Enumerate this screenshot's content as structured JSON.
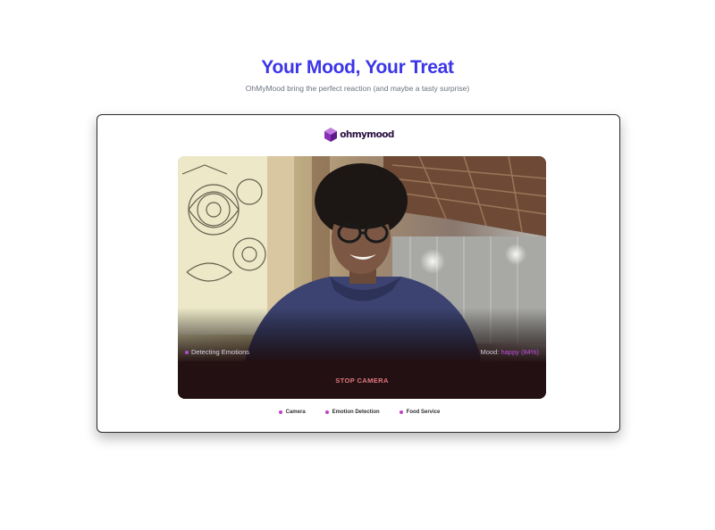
{
  "header": {
    "title": "Your Mood, Your Treat",
    "subtitle": "OhMyMood bring the perfect reaction (and maybe a tasty surprise)"
  },
  "app": {
    "logo_text": "ohmymood",
    "logo_icon": "purple-cube-icon"
  },
  "camera": {
    "status_label": "Detecting Emotions",
    "mood_label": "Mood:",
    "mood_value": "happy (84%)",
    "stop_button_label": "STOP CAMERA"
  },
  "features": [
    {
      "label": "Camera"
    },
    {
      "label": "Emotion Detection"
    },
    {
      "label": "Food Service"
    }
  ],
  "colors": {
    "title": "#3b35e8",
    "accent": "#b34bd6",
    "stop_button_text": "#e2787f",
    "stop_button_bg": "#231012"
  }
}
